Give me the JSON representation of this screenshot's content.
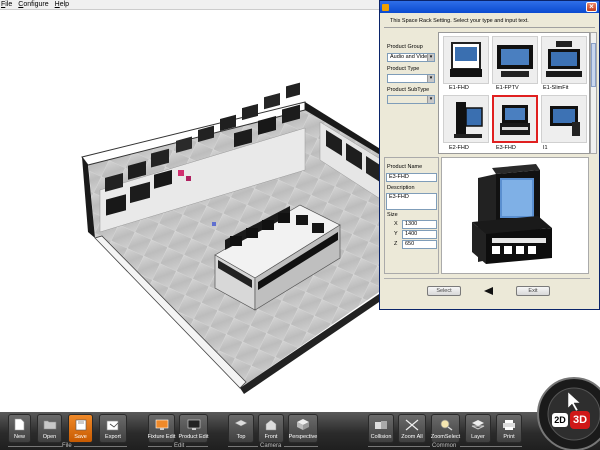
{
  "menu": {
    "items": [
      "File",
      "Configure",
      "Help"
    ]
  },
  "toolbar": {
    "groups": {
      "file": "File",
      "edit": "Edit",
      "camera": "Camera",
      "common": "Common"
    },
    "buttons": {
      "new": "New",
      "open": "Open",
      "save": "Save",
      "export": "Export",
      "fixture_edit": "Fixture Edit",
      "product_edit": "Product Edit",
      "top": "Top",
      "front": "Front",
      "perspective": "Perspective",
      "collision": "Collision",
      "zoom_all": "Zoom All",
      "zoom_select": "ZoomSelect",
      "layer": "Layer",
      "print": "Print"
    },
    "active_button": "save",
    "accent_color": "#e8761a"
  },
  "dial": {
    "label_2d": "2D",
    "label_3d": "3D",
    "active": "3D"
  },
  "dialog": {
    "instruction": "This Space Rack Setting. Select your type and input text.",
    "product_group": {
      "label": "Product Group",
      "value": "Audio and Video"
    },
    "product_type": {
      "label": "Product Type",
      "value": ""
    },
    "product_subtype": {
      "label": "Product SubType",
      "value": ""
    },
    "thumbnails": [
      {
        "name": "E1-FHD"
      },
      {
        "name": "E1-FPTV"
      },
      {
        "name": "E1-SlimFit"
      },
      {
        "name": "E2-FHD"
      },
      {
        "name": "E3-FHD",
        "selected": true
      },
      {
        "name": "I1"
      }
    ],
    "product_name": {
      "label": "Product Name",
      "value": "E3-FHD"
    },
    "description": {
      "label": "Description",
      "value": "E3-FHD"
    },
    "size": {
      "label": "Size",
      "x_label": "X",
      "x": "1300",
      "y_label": "Y",
      "y": "1400",
      "z_label": "Z",
      "z": "650"
    },
    "select_button": "Select",
    "exit_button": "Exit",
    "selection_border_color": "#e02020"
  }
}
